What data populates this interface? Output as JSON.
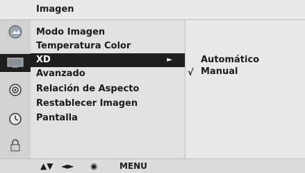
{
  "header": {
    "title": "Imagen"
  },
  "menu": {
    "items": [
      {
        "label": "Modo Imagen"
      },
      {
        "label": "Temperatura Color"
      },
      {
        "label": "XD",
        "active": true,
        "arrow": "►"
      },
      {
        "label": "Avanzado"
      },
      {
        "label": "Relación de Aspecto"
      },
      {
        "label": "Restablecer Imagen"
      },
      {
        "label": "Pantalla"
      }
    ]
  },
  "submenu": {
    "options": [
      {
        "label": "Automático",
        "selected": false
      },
      {
        "label": "Manual",
        "selected": true,
        "mark": "√"
      }
    ]
  },
  "side_icons": [
    "picture-icon",
    "screen-icon",
    "circle-target-icon",
    "clock-icon",
    "lock-icon"
  ],
  "footer": {
    "updown": "▲▼",
    "leftright": "◄►",
    "ok": "◉",
    "menu": "MENU"
  },
  "colors": {
    "active_bg": "#1e1e1e",
    "panel_bg": "#e2e2e2"
  }
}
